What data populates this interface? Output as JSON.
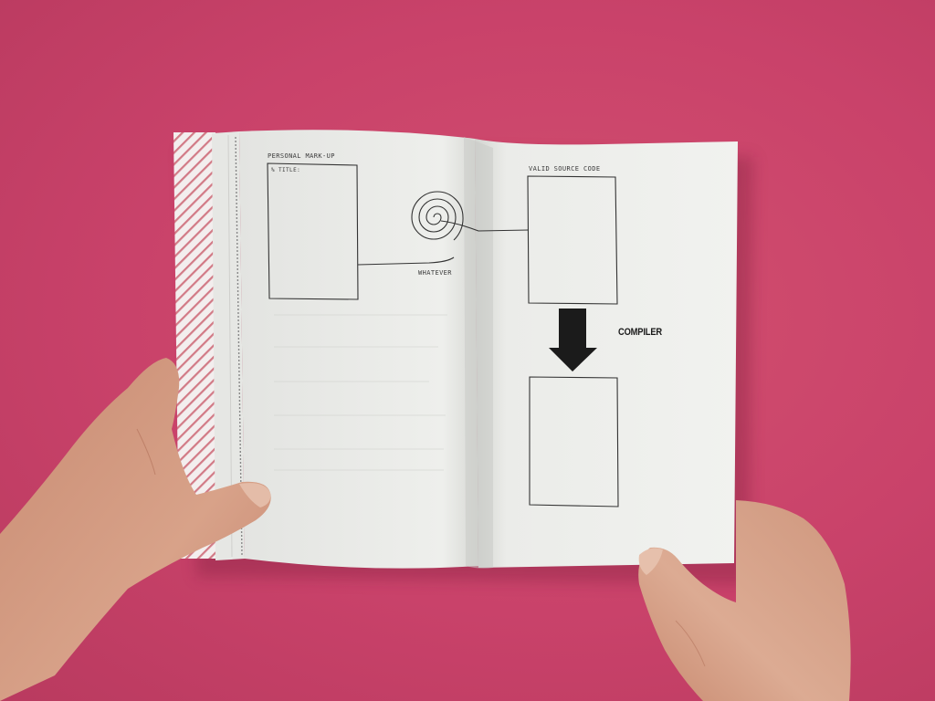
{
  "book": {
    "left_page": {
      "heading": "PERSONAL MARK-UP",
      "field_label": "% TITLE:",
      "spiral_caption": "WHATEVER"
    },
    "right_page": {
      "heading": "VALID SOURCE CODE",
      "arrow_label": "COMPILER"
    }
  },
  "colors": {
    "background": "#c9426a",
    "paper": "#ecedea",
    "ink": "#1a1a1a",
    "skin": "#d49c84"
  },
  "icons": [
    "spiral-icon",
    "down-arrow-icon",
    "connector-line-icon"
  ]
}
